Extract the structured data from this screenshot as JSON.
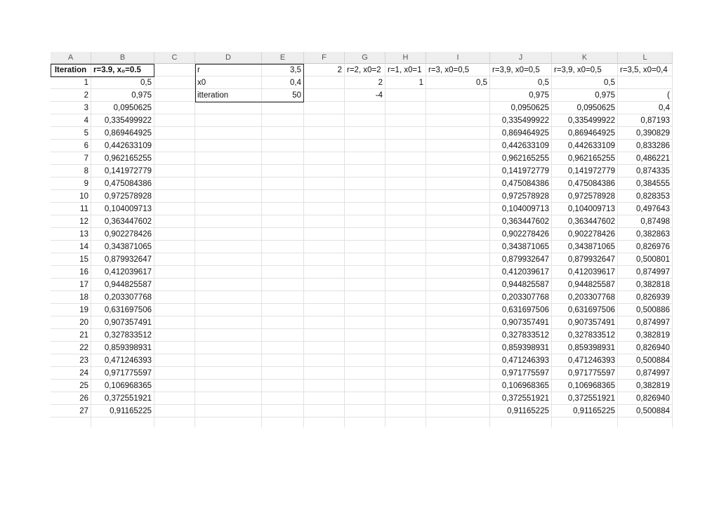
{
  "columns": [
    "A",
    "B",
    "C",
    "D",
    "E",
    "F",
    "G",
    "H",
    "I",
    "J",
    "K",
    "L"
  ],
  "header_row": {
    "A": "Iteration",
    "B": "r=3.9, x₀=0.5",
    "C": "",
    "D": "r",
    "E": "3,5",
    "F": "2",
    "G": "r=2, x0=2",
    "H": "r=1, x0=1",
    "I": "r=3, x0=0,5",
    "J": "r=3,9, x0=0,5",
    "K": "r=3,9, x0=0,5",
    "L": "r=3,5, x0=0,4"
  },
  "rows": [
    {
      "A": "1",
      "B": "0,5",
      "D": "x0",
      "E": "0,4",
      "G": "2",
      "H": "1",
      "I": "0,5",
      "J": "0,5",
      "K": "0,5",
      "L": ""
    },
    {
      "A": "2",
      "B": "0,975",
      "D": "itteration",
      "E": "50",
      "G": "-4",
      "J": "0,975",
      "K": "0,975",
      "L": "("
    },
    {
      "A": "3",
      "B": "0,0950625",
      "J": "0,0950625",
      "K": "0,0950625",
      "L": "0,4"
    },
    {
      "A": "4",
      "B": "0,335499922",
      "J": "0,335499922",
      "K": "0,335499922",
      "L": "0,87193"
    },
    {
      "A": "5",
      "B": "0,869464925",
      "J": "0,869464925",
      "K": "0,869464925",
      "L": "0,390829"
    },
    {
      "A": "6",
      "B": "0,442633109",
      "J": "0,442633109",
      "K": "0,442633109",
      "L": "0,833286"
    },
    {
      "A": "7",
      "B": "0,962165255",
      "J": "0,962165255",
      "K": "0,962165255",
      "L": "0,486221"
    },
    {
      "A": "8",
      "B": "0,141972779",
      "J": "0,141972779",
      "K": "0,141972779",
      "L": "0,874335"
    },
    {
      "A": "9",
      "B": "0,475084386",
      "J": "0,475084386",
      "K": "0,475084386",
      "L": "0,384555"
    },
    {
      "A": "10",
      "B": "0,972578928",
      "J": "0,972578928",
      "K": "0,972578928",
      "L": "0,828353"
    },
    {
      "A": "11",
      "B": "0,104009713",
      "J": "0,104009713",
      "K": "0,104009713",
      "L": "0,497643"
    },
    {
      "A": "12",
      "B": "0,363447602",
      "J": "0,363447602",
      "K": "0,363447602",
      "L": "0,87498"
    },
    {
      "A": "13",
      "B": "0,902278426",
      "J": "0,902278426",
      "K": "0,902278426",
      "L": "0,382863"
    },
    {
      "A": "14",
      "B": "0,343871065",
      "J": "0,343871065",
      "K": "0,343871065",
      "L": "0,826976"
    },
    {
      "A": "15",
      "B": "0,879932647",
      "J": "0,879932647",
      "K": "0,879932647",
      "L": "0,500801"
    },
    {
      "A": "16",
      "B": "0,412039617",
      "J": "0,412039617",
      "K": "0,412039617",
      "L": "0,874997"
    },
    {
      "A": "17",
      "B": "0,944825587",
      "J": "0,944825587",
      "K": "0,944825587",
      "L": "0,382818"
    },
    {
      "A": "18",
      "B": "0,203307768",
      "J": "0,203307768",
      "K": "0,203307768",
      "L": "0,826939"
    },
    {
      "A": "19",
      "B": "0,631697506",
      "J": "0,631697506",
      "K": "0,631697506",
      "L": "0,500886"
    },
    {
      "A": "20",
      "B": "0,907357491",
      "J": "0,907357491",
      "K": "0,907357491",
      "L": "0,874997"
    },
    {
      "A": "21",
      "B": "0,327833512",
      "J": "0,327833512",
      "K": "0,327833512",
      "L": "0,382819"
    },
    {
      "A": "22",
      "B": "0,859398931",
      "J": "0,859398931",
      "K": "0,859398931",
      "L": "0,826940"
    },
    {
      "A": "23",
      "B": "0,471246393",
      "J": "0,471246393",
      "K": "0,471246393",
      "L": "0,500884"
    },
    {
      "A": "24",
      "B": "0,971775597",
      "J": "0,971775597",
      "K": "0,971775597",
      "L": "0,874997"
    },
    {
      "A": "25",
      "B": "0,106968365",
      "J": "0,106968365",
      "K": "0,106968365",
      "L": "0,382819"
    },
    {
      "A": "26",
      "B": "0,372551921",
      "J": "0,372551921",
      "K": "0,372551921",
      "L": "0,826940"
    },
    {
      "A": "27",
      "B": "0,91165225",
      "J": "0,91165225",
      "K": "0,91165225",
      "L": "0,500884"
    }
  ]
}
